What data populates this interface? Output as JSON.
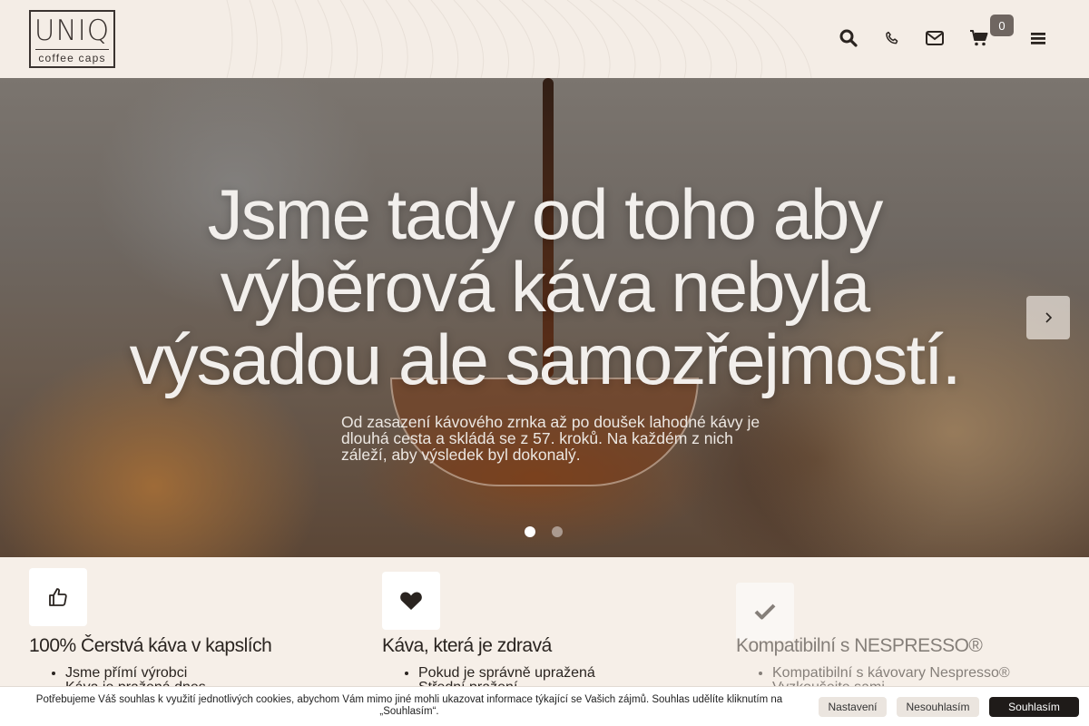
{
  "header": {
    "logo": {
      "main": "UNIQ",
      "sub": "coffee caps"
    },
    "cart_count": "0",
    "icons": [
      "search-icon",
      "phone-icon",
      "envelope-icon",
      "cart-icon",
      "menu-icon"
    ]
  },
  "hero": {
    "title_lines": [
      "Jsme tady od toho aby",
      "výběrová káva nebyla",
      "výsadou ale samozřejmostí."
    ],
    "subtitle_lines": [
      "Od zasazení kávového zrnka až po doušek lahodné kávy je",
      "dlouhá cesta a skládá se z 57. kroků. Na každém z nich",
      "záleží, aby výsledek byl dokonalý."
    ],
    "slides": 2,
    "active_slide": 1
  },
  "features": [
    {
      "icon": "thumbs-up-icon",
      "title": "100% Čerstvá káva v kapslích",
      "items": [
        "Jsme přímí výrobci",
        "Káva je pražená dnes"
      ]
    },
    {
      "icon": "heart-icon",
      "title": "Káva, která je zdravá",
      "items": [
        "Pokud je správně upražená",
        "Střední pražení"
      ]
    },
    {
      "icon": "check-icon",
      "title": "Kompatibilní s NESPRESSO®",
      "items": [
        "Kompatibilní s kávovary Nespresso®",
        "Vyzkoušejte sami"
      ]
    }
  ],
  "cookie": {
    "text_lines": [
      "Potřebujeme Váš souhlas k využití jednotlivých cookies, abychom Vám mimo jiné mohli ukazovat informace týkající se Vašich zájmů. Souhlas udělíte kliknutím na",
      "„Souhlasím“."
    ],
    "settings_label": "Nastavení",
    "decline_label": "Nesouhlasím",
    "accept_label": "Souhlasím"
  },
  "colors": {
    "header_bg": "#f4ede6",
    "page_bg": "#f6efe8",
    "badge": "#6f6661",
    "accept_button": "#1f1b19"
  }
}
